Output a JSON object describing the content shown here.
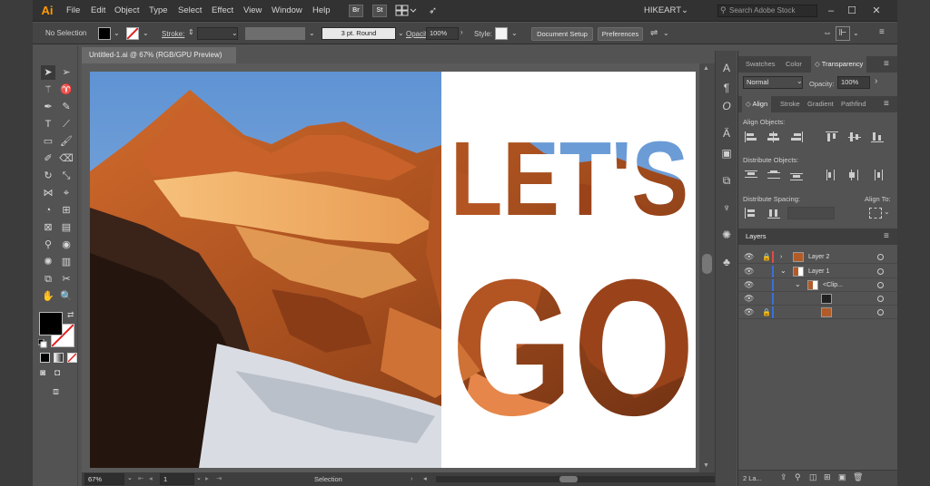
{
  "app": {
    "logo": "Ai",
    "workspace": "HIKEART",
    "search_placeholder": "Search Adobe Stock"
  },
  "menu": [
    "File",
    "Edit",
    "Object",
    "Type",
    "Select",
    "Effect",
    "View",
    "Window",
    "Help"
  ],
  "menubar_icons": {
    "br": "Br",
    "st": "St"
  },
  "control": {
    "selection": "No Selection",
    "stroke_label": "Stroke:",
    "brush": "3 pt. Round",
    "opacity_label": "Opacity:",
    "opacity_value": "100%",
    "style_label": "Style:",
    "document_setup": "Document Setup",
    "preferences": "Preferences"
  },
  "document": {
    "tab_title": "Untitled-1.ai @ 67% (RGB/GPU Preview)"
  },
  "artwork": {
    "line1": "LET'S",
    "line2": "GO"
  },
  "status": {
    "zoom": "67%",
    "artboard": "1",
    "tool": "Selection"
  },
  "panels": {
    "top_tabs": [
      "Swatches",
      "Color",
      "Transparency"
    ],
    "blend_mode": "Normal",
    "opacity_label": "Opacity:",
    "opacity_value": "100%",
    "mid_tabs": [
      "Align",
      "Stroke",
      "Gradient",
      "Pathfind"
    ],
    "align_objects": "Align Objects:",
    "distribute_objects": "Distribute Objects:",
    "distribute_spacing": "Distribute Spacing:",
    "align_to": "Align To:",
    "layers_title": "Layers",
    "layers": [
      {
        "name": "Layer 2"
      },
      {
        "name": "Layer 1"
      },
      {
        "name": "<Clip..."
      },
      {
        "name": ""
      },
      {
        "name": ""
      }
    ],
    "layers_count": "2 La..."
  },
  "colors": {
    "accent_layer2": "#e04a4a",
    "accent_layer1": "#3a6fd8",
    "logo": "#ff9a00",
    "sky": "#6f9ed6"
  }
}
